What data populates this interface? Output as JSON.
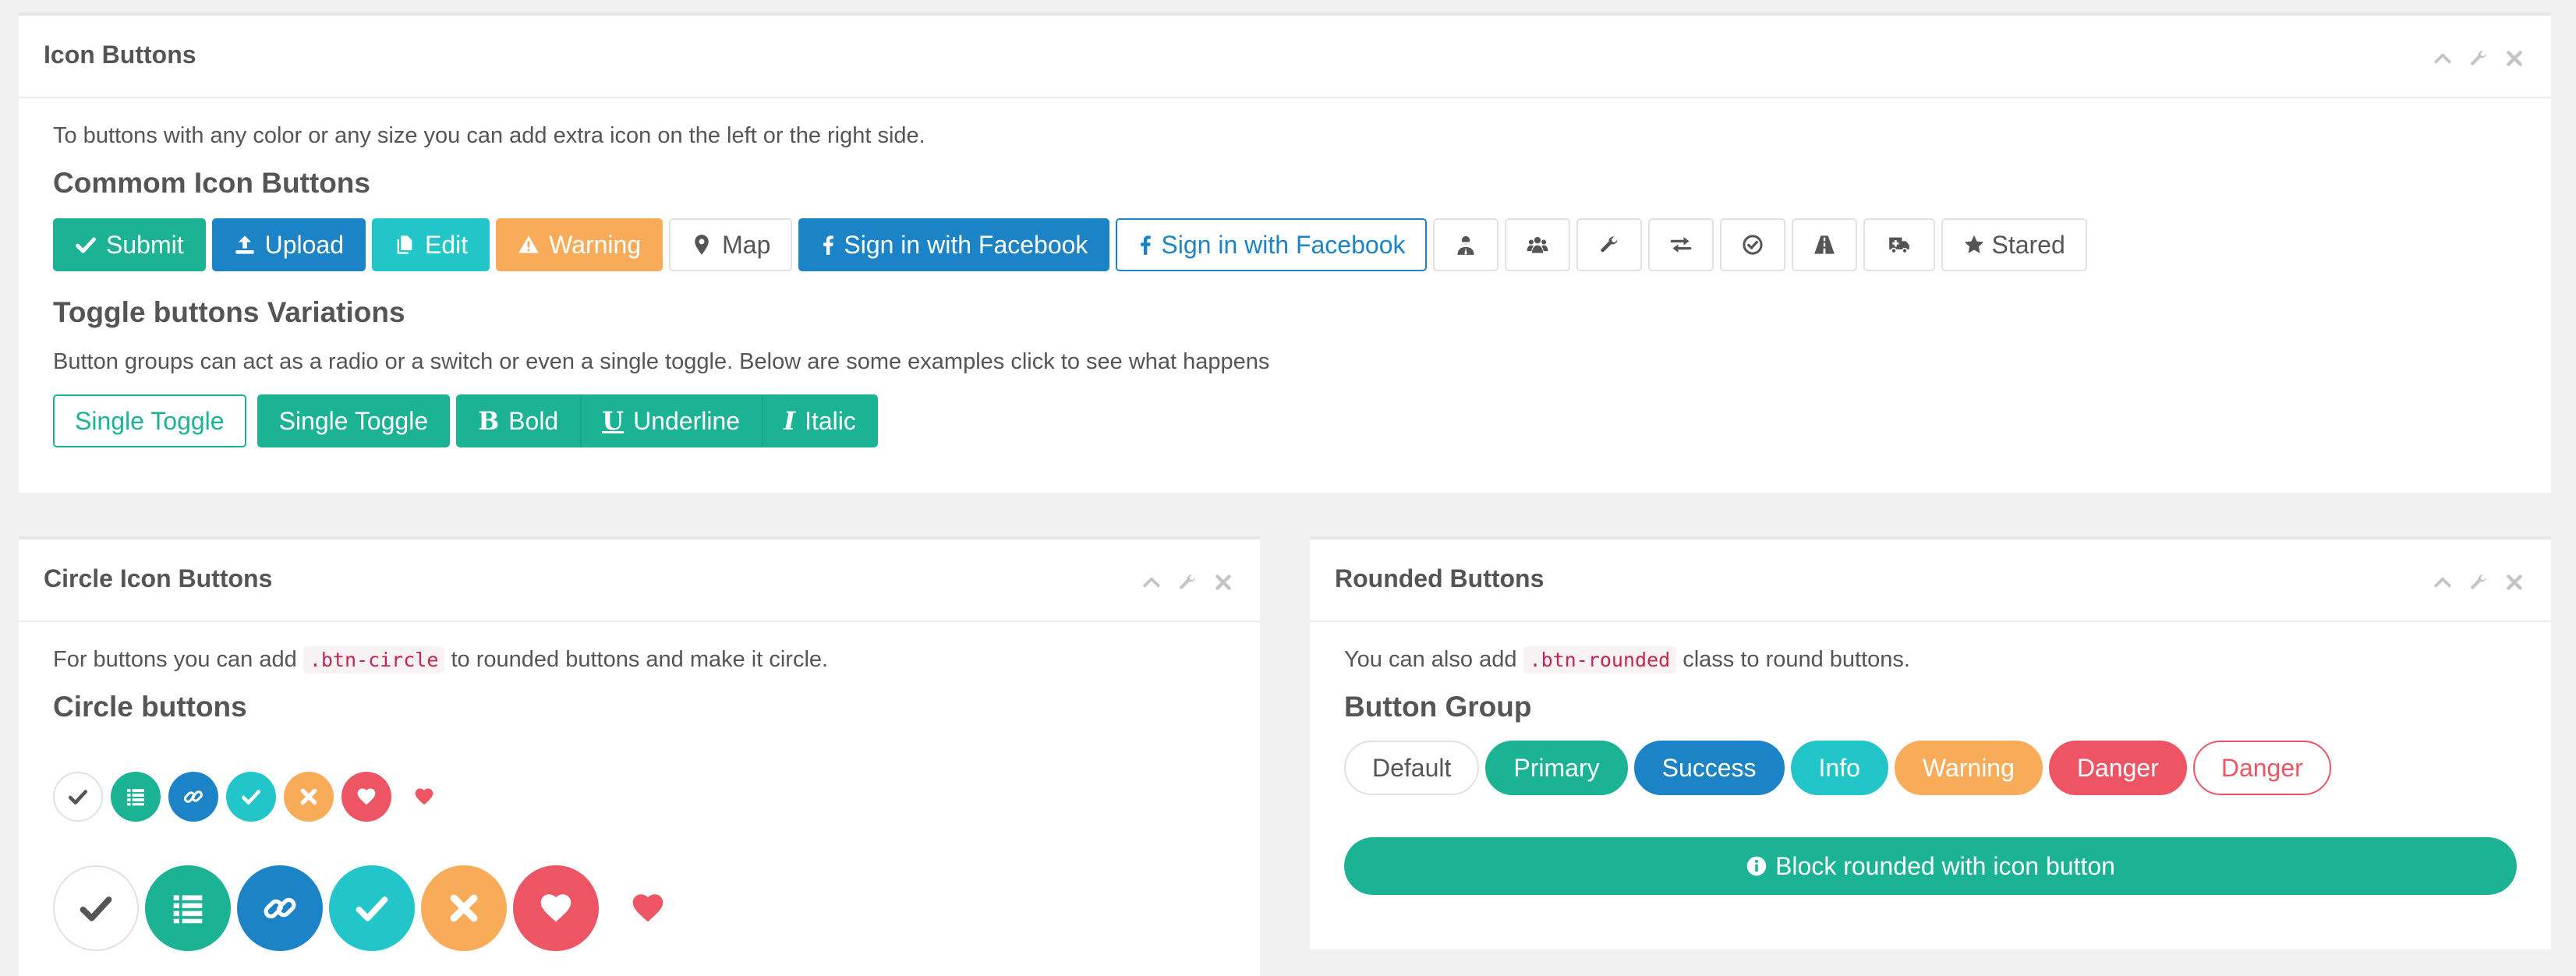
{
  "icon_panel": {
    "title": "Icon Buttons",
    "description": "To buttons with any color or any size you can add extra icon on the left or the right side.",
    "common_heading": "Commom Icon Buttons",
    "buttons": {
      "submit": "Submit",
      "upload": "Upload",
      "edit": "Edit",
      "warning": "Warning",
      "map": "Map",
      "facebook": "Sign in with Facebook",
      "facebook_outline": "Sign in with Facebook",
      "stared": "Stared"
    },
    "icon_only_buttons": [
      "user-secret-icon",
      "users-icon",
      "wrench-icon",
      "exchange-icon",
      "check-circle-icon",
      "road-icon",
      "ambulance-icon"
    ],
    "toggle_heading": "Toggle buttons Variations",
    "toggle_description": "Button groups can act as a radio or a switch or even a single toggle. Below are some examples click to see what happens",
    "toggles": {
      "single_outline": "Single Toggle",
      "single_filled": "Single Toggle",
      "bold_glyph": "B",
      "bold": "Bold",
      "underline_glyph": "U",
      "underline": "Underline",
      "italic_glyph": "I",
      "italic": "Italic"
    }
  },
  "circle_panel": {
    "title": "Circle Icon Buttons",
    "desc_before": "For buttons you can add",
    "code": ".btn-circle",
    "desc_after": "to rounded buttons and make it circle.",
    "heading": "Circle buttons",
    "circle_icons": [
      "check-icon",
      "list-icon",
      "link-icon",
      "check-icon",
      "times-icon",
      "heart-icon",
      "heart-icon"
    ]
  },
  "rounded_panel": {
    "title": "Rounded Buttons",
    "desc_before": "You can also add",
    "code": ".btn-rounded",
    "desc_after": "class to round buttons.",
    "heading": "Button Group",
    "buttons": {
      "default": "Default",
      "primary": "Primary",
      "success": "Success",
      "info": "Info",
      "warning": "Warning",
      "danger": "Danger",
      "danger_outline": "Danger"
    },
    "block_button": "Block rounded with icon button"
  },
  "colors": {
    "primary": "#1cb394",
    "success": "#1c84c6",
    "info": "#23c6c8",
    "warning": "#f8ac59",
    "danger": "#ed5565",
    "background": "#f1f1f1"
  }
}
